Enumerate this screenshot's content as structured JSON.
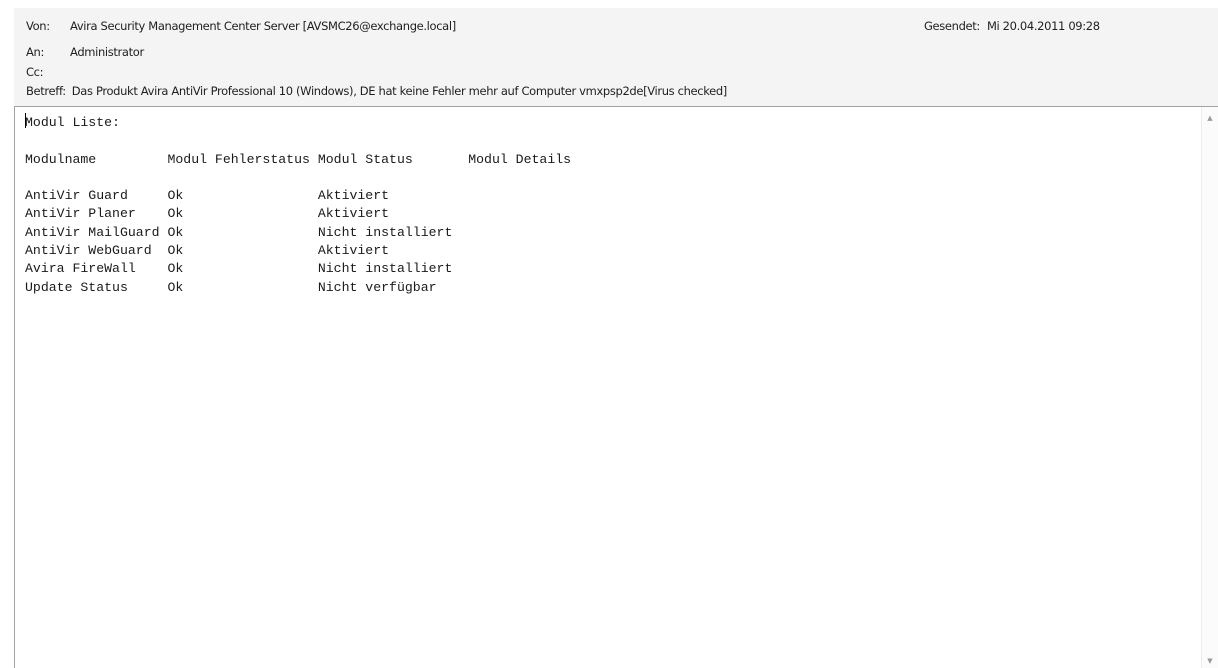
{
  "header": {
    "from_label": "Von:",
    "from_value": "Avira Security Management Center Server [AVSMC26@exchange.local]",
    "to_label": "An:",
    "to_value": "Administrator",
    "cc_label": "Cc:",
    "cc_value": "",
    "subject_label": "Betreff:",
    "subject_value": "Das Produkt Avira AntiVir Professional 10 (Windows), DE hat keine Fehler mehr auf Computer vmxpsp2de[Virus checked]",
    "sent_label": "Gesendet:",
    "sent_value": "Mi 20.04.2011 09:28"
  },
  "body": {
    "title": "Modul Liste:",
    "columns": [
      "Modulname",
      "Modul Fehlerstatus",
      "Modul Status",
      "Modul Details"
    ],
    "rows": [
      [
        "AntiVir Guard",
        "Ok",
        "Aktiviert",
        ""
      ],
      [
        "AntiVir Planer",
        "Ok",
        "Aktiviert",
        ""
      ],
      [
        "AntiVir MailGuard",
        "Ok",
        "Nicht installiert",
        ""
      ],
      [
        "AntiVir WebGuard",
        "Ok",
        "Aktiviert",
        ""
      ],
      [
        "Avira FireWall",
        "Ok",
        "Nicht installiert",
        ""
      ],
      [
        "Update Status",
        "Ok",
        "Nicht verfügbar",
        ""
      ]
    ]
  },
  "scrollbar": {
    "up_icon": "scroll-up-arrow",
    "down_icon": "scroll-down-arrow"
  }
}
